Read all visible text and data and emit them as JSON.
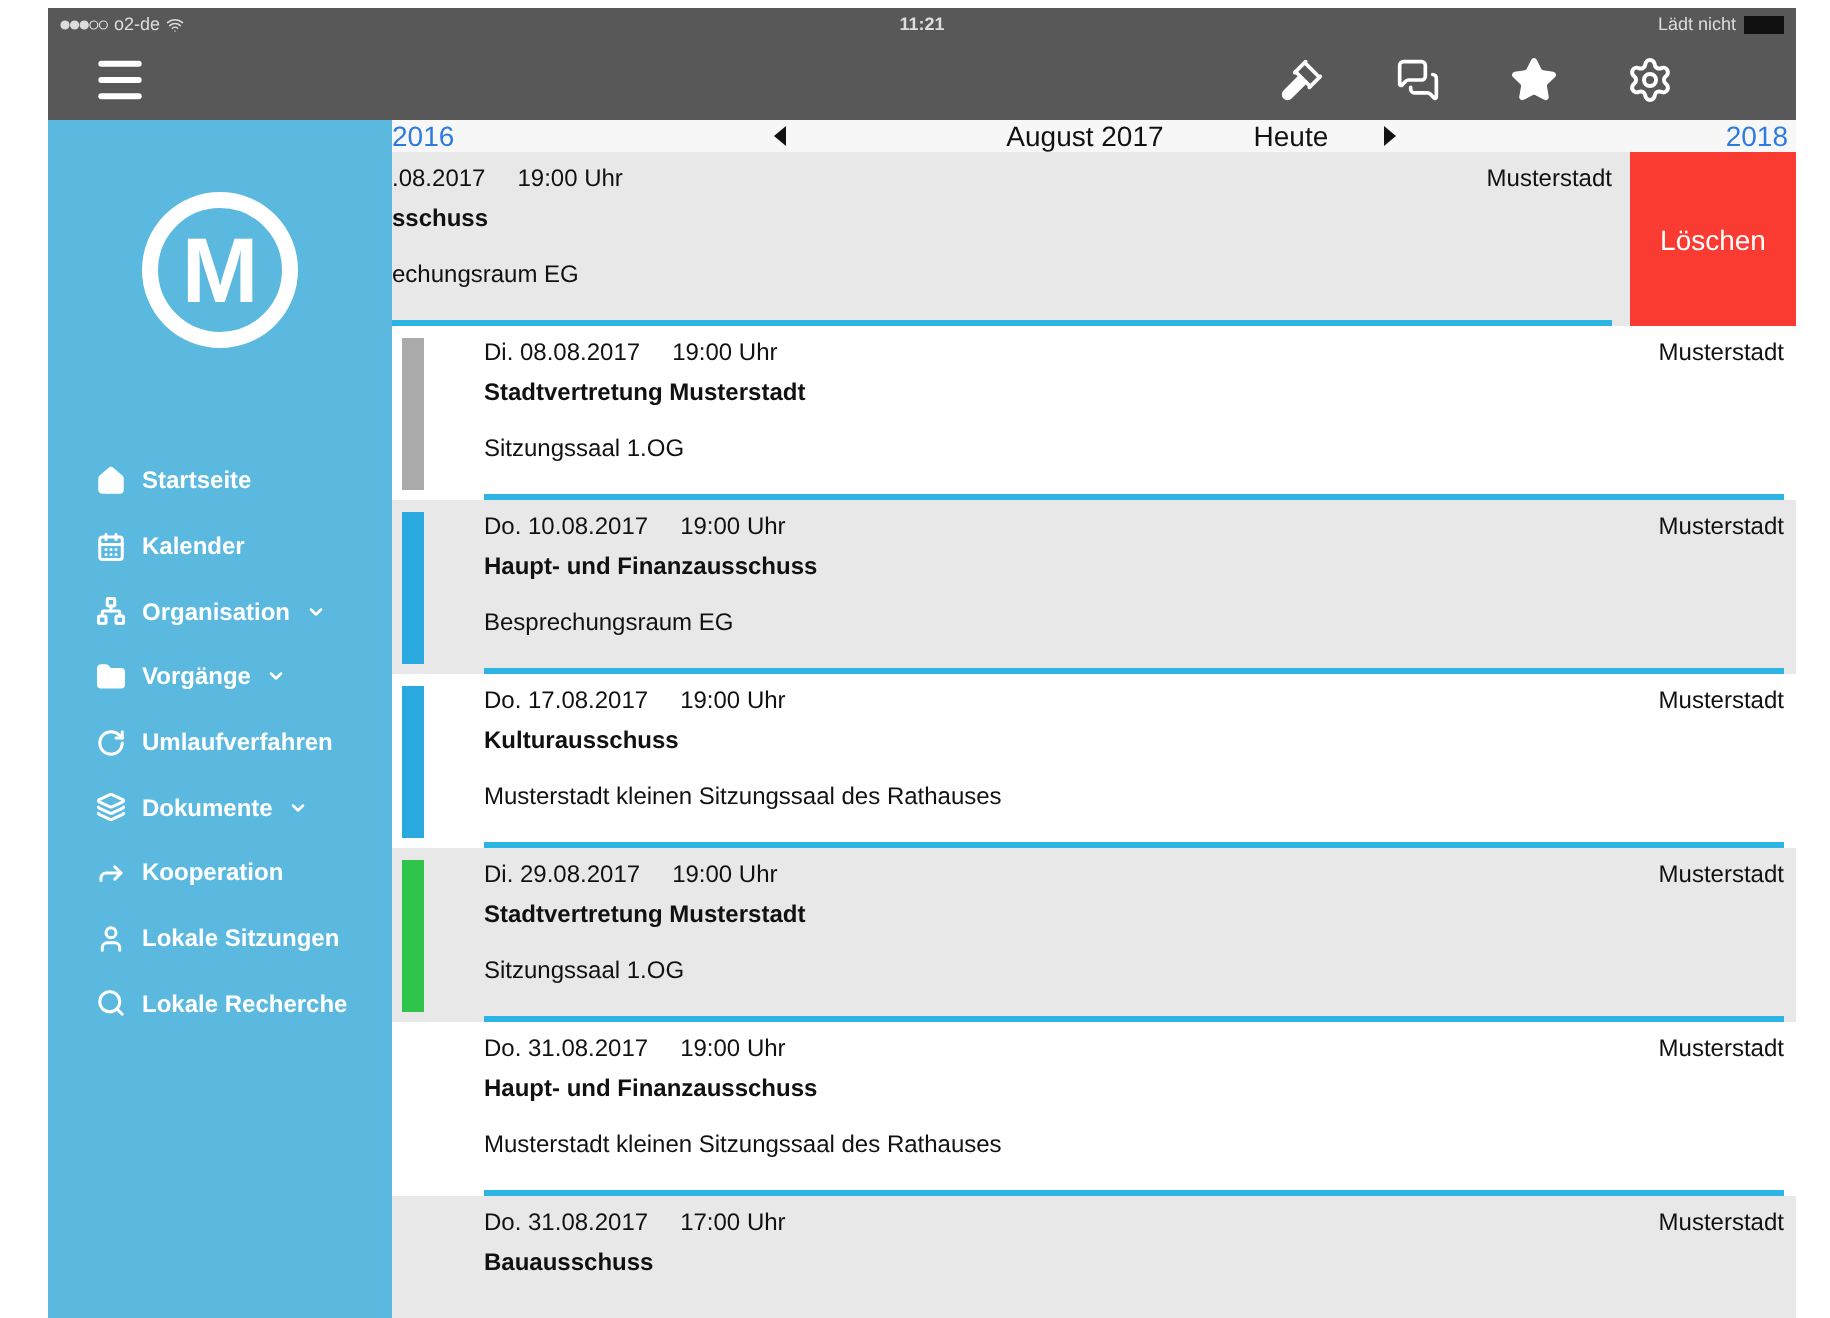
{
  "status_bar": {
    "carrier": "o2-de",
    "time": "11:21",
    "charging": "Lädt nicht"
  },
  "logo": {
    "letter": "M"
  },
  "menu": [
    {
      "label": "Startseite",
      "dropdown": false
    },
    {
      "label": "Kalender",
      "dropdown": false
    },
    {
      "label": "Organisation",
      "dropdown": true
    },
    {
      "label": "Vorgänge",
      "dropdown": true
    },
    {
      "label": "Umlaufverfahren",
      "dropdown": false
    },
    {
      "label": "Dokumente",
      "dropdown": true
    },
    {
      "label": "Kooperation",
      "dropdown": false
    },
    {
      "label": "Lokale Sitzungen",
      "dropdown": false
    },
    {
      "label": "Lokale Recherche",
      "dropdown": false
    }
  ],
  "month_nav": {
    "previous_year": "2016",
    "current": "August 2017",
    "today": "Heute",
    "next_year": "2018"
  },
  "meetings": [
    {
      "kind": "swiped",
      "date": ".08.2017",
      "time": "19:00 Uhr",
      "title": "sschuss",
      "location": "echungsraum EG",
      "city": "Musterstadt",
      "action": "Löschen"
    },
    {
      "kind": "normal",
      "date": "Di.  08.08.2017",
      "time": "19:00 Uhr",
      "title": "Stadtvertretung Musterstadt",
      "location": "Sitzungssaal 1.OG",
      "city": "Musterstadt",
      "color": "#aaaaaa"
    },
    {
      "kind": "normal",
      "date": "Do.  10.08.2017",
      "time": "19:00 Uhr",
      "title": "Haupt- und Finanzausschuss",
      "location": "Besprechungsraum EG",
      "city": "Musterstadt",
      "color": "#29a9df"
    },
    {
      "kind": "normal",
      "date": "Do.  17.08.2017",
      "time": "19:00 Uhr",
      "title": "Kulturausschuss",
      "location": "Musterstadt kleinen Sitzungssaal des Rathauses",
      "city": "Musterstadt",
      "color": "#29a9df"
    },
    {
      "kind": "normal",
      "date": "Di.  29.08.2017",
      "time": "19:00 Uhr",
      "title": "Stadtvertretung Musterstadt",
      "location": "Sitzungssaal 1.OG",
      "city": "Musterstadt",
      "color": "#2fc44a"
    },
    {
      "kind": "normal",
      "date": "Do.  31.08.2017",
      "time": "19:00 Uhr",
      "title": "Haupt- und Finanzausschuss",
      "location": "Musterstadt kleinen Sitzungssaal des Rathauses",
      "city": "Musterstadt"
    },
    {
      "kind": "normal",
      "date": "Do.  31.08.2017",
      "time": "17:00 Uhr",
      "title": "Bauausschuss",
      "city": "Musterstadt"
    }
  ]
}
